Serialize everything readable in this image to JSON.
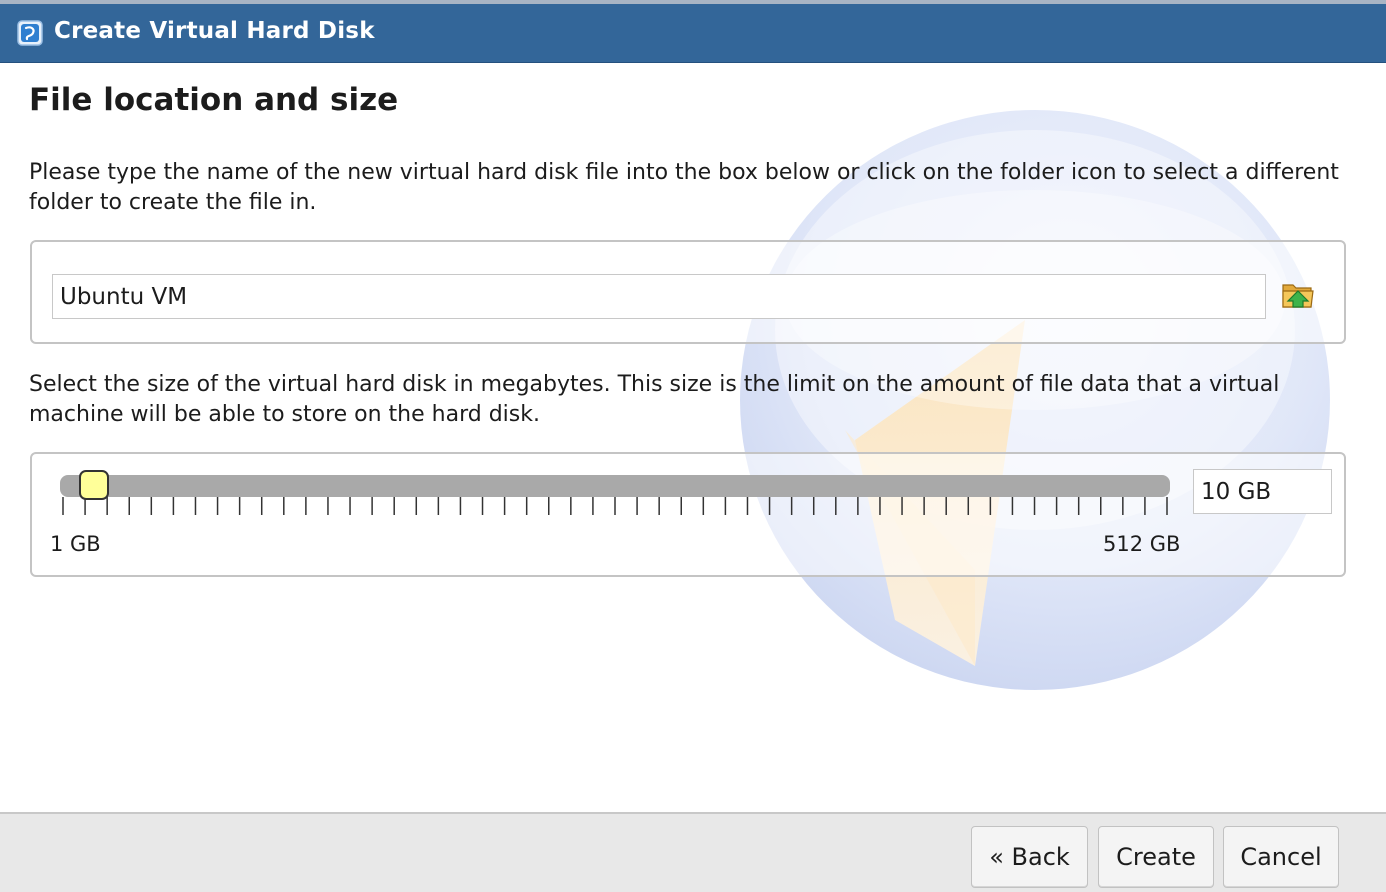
{
  "window": {
    "title": "Create Virtual Hard Disk",
    "icon": "virtualbox-icon"
  },
  "page": {
    "heading": "File location and size",
    "location_description": "Please type the name of the new virtual hard disk file into the box below or click on the folder icon to select a different folder to create the file in.",
    "size_description": "Select the size of the virtual hard disk in megabytes. This size is the limit on the amount of file data that a virtual machine will be able to store on the hard disk."
  },
  "file_location": {
    "value": "Ubuntu VM",
    "folder_icon": "folder-open-icon"
  },
  "size": {
    "min_label": "1 GB",
    "max_label": "512 GB",
    "value_text": "10 GB",
    "slider_value_gb": 10,
    "slider_min_gb": 1,
    "slider_max_gb": 512
  },
  "buttons": {
    "back": "« Back",
    "create": "Create",
    "cancel": "Cancel"
  },
  "colors": {
    "titlebar": "#336699",
    "slider_thumb": "#ffff99",
    "slider_track": "#a9a9a9"
  }
}
